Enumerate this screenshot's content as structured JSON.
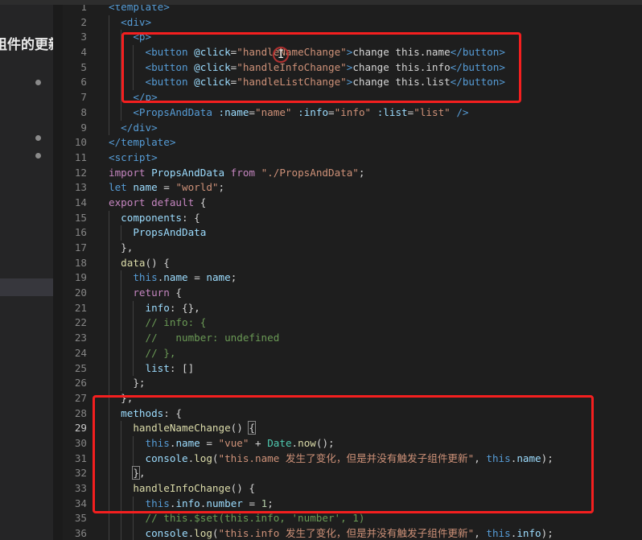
{
  "side_panel": {
    "title": "组件的更新"
  },
  "cursor": {
    "glyph": "I"
  },
  "colors": {
    "annotation_box": "#f41f1f",
    "keyword": "#c586c0",
    "string": "#ce9178",
    "comment": "#6a9955",
    "tag": "#569cd6"
  },
  "editor": {
    "active_line": 29,
    "lines": [
      {
        "n": "1",
        "t": [
          [
            "tag",
            "<template>"
          ]
        ]
      },
      {
        "n": "2",
        "t": [
          [
            "txt",
            "  "
          ],
          [
            "tag",
            "<div>"
          ]
        ]
      },
      {
        "n": "3",
        "t": [
          [
            "txt",
            "    "
          ],
          [
            "tag",
            "<p>"
          ]
        ]
      },
      {
        "n": "4",
        "t": [
          [
            "txt",
            "      "
          ],
          [
            "tag",
            "<button "
          ],
          [
            "attr",
            "@click"
          ],
          [
            "txt",
            "="
          ],
          [
            "str",
            "\"handleNameChange\""
          ],
          [
            "tag",
            ">"
          ],
          [
            "txt",
            "change this.name"
          ],
          [
            "tag",
            "</button>"
          ]
        ]
      },
      {
        "n": "5",
        "t": [
          [
            "txt",
            "      "
          ],
          [
            "tag",
            "<button "
          ],
          [
            "attr",
            "@click"
          ],
          [
            "txt",
            "="
          ],
          [
            "str",
            "\"handleInfoChange\""
          ],
          [
            "tag",
            ">"
          ],
          [
            "txt",
            "change this.info"
          ],
          [
            "tag",
            "</button>"
          ]
        ]
      },
      {
        "n": "6",
        "t": [
          [
            "txt",
            "      "
          ],
          [
            "tag",
            "<button "
          ],
          [
            "attr",
            "@click"
          ],
          [
            "txt",
            "="
          ],
          [
            "str",
            "\"handleListChange\""
          ],
          [
            "tag",
            ">"
          ],
          [
            "txt",
            "change this.list"
          ],
          [
            "tag",
            "</button>"
          ]
        ]
      },
      {
        "n": "7",
        "t": [
          [
            "txt",
            "    "
          ],
          [
            "tag",
            "</p>"
          ]
        ]
      },
      {
        "n": "8",
        "t": [
          [
            "txt",
            "    "
          ],
          [
            "tag",
            "<PropsAndData "
          ],
          [
            "attr",
            ":name"
          ],
          [
            "txt",
            "="
          ],
          [
            "str",
            "\"name\""
          ],
          [
            "txt",
            " "
          ],
          [
            "attr",
            ":info"
          ],
          [
            "txt",
            "="
          ],
          [
            "str",
            "\"info\""
          ],
          [
            "txt",
            " "
          ],
          [
            "attr",
            ":list"
          ],
          [
            "txt",
            "="
          ],
          [
            "str",
            "\"list\""
          ],
          [
            "txt",
            " "
          ],
          [
            "tag",
            "/>"
          ]
        ]
      },
      {
        "n": "9",
        "t": [
          [
            "txt",
            "  "
          ],
          [
            "tag",
            "</div>"
          ]
        ]
      },
      {
        "n": "10",
        "t": [
          [
            "tag",
            "</template>"
          ]
        ]
      },
      {
        "n": "11",
        "t": [
          [
            "tag",
            "<script>"
          ]
        ]
      },
      {
        "n": "12",
        "t": [
          [
            "kw",
            "import "
          ],
          [
            "var",
            "PropsAndData "
          ],
          [
            "kw",
            "from "
          ],
          [
            "str",
            "\"./PropsAndData\""
          ],
          [
            "txt",
            ";"
          ]
        ]
      },
      {
        "n": "13",
        "t": [
          [
            "kwb",
            "let "
          ],
          [
            "var",
            "name"
          ],
          [
            "txt",
            " = "
          ],
          [
            "str",
            "\"world\""
          ],
          [
            "txt",
            ";"
          ]
        ]
      },
      {
        "n": "14",
        "t": [
          [
            "kw",
            "export default "
          ],
          [
            "txt",
            "{"
          ]
        ]
      },
      {
        "n": "15",
        "t": [
          [
            "txt",
            "  "
          ],
          [
            "var",
            "components"
          ],
          [
            "txt",
            ": {"
          ]
        ]
      },
      {
        "n": "16",
        "t": [
          [
            "txt",
            "    "
          ],
          [
            "var",
            "PropsAndData"
          ]
        ]
      },
      {
        "n": "17",
        "t": [
          [
            "txt",
            "  },"
          ]
        ]
      },
      {
        "n": "18",
        "t": [
          [
            "txt",
            "  "
          ],
          [
            "fn",
            "data"
          ],
          [
            "txt",
            "() {"
          ]
        ]
      },
      {
        "n": "19",
        "t": [
          [
            "txt",
            "    "
          ],
          [
            "kwb",
            "this"
          ],
          [
            "txt",
            "."
          ],
          [
            "var",
            "name"
          ],
          [
            "txt",
            " = "
          ],
          [
            "var",
            "name"
          ],
          [
            "txt",
            ";"
          ]
        ]
      },
      {
        "n": "20",
        "t": [
          [
            "txt",
            "    "
          ],
          [
            "kw",
            "return "
          ],
          [
            "txt",
            "{"
          ]
        ]
      },
      {
        "n": "21",
        "t": [
          [
            "txt",
            "      "
          ],
          [
            "var",
            "info"
          ],
          [
            "txt",
            ": {},"
          ]
        ]
      },
      {
        "n": "22",
        "t": [
          [
            "txt",
            "      "
          ],
          [
            "cmt",
            "// info: {"
          ]
        ]
      },
      {
        "n": "23",
        "t": [
          [
            "txt",
            "      "
          ],
          [
            "cmt",
            "//   number: undefined"
          ]
        ]
      },
      {
        "n": "24",
        "t": [
          [
            "txt",
            "      "
          ],
          [
            "cmt",
            "// },"
          ]
        ]
      },
      {
        "n": "25",
        "t": [
          [
            "txt",
            "      "
          ],
          [
            "var",
            "list"
          ],
          [
            "txt",
            ": []"
          ]
        ]
      },
      {
        "n": "26",
        "t": [
          [
            "txt",
            "    };"
          ]
        ]
      },
      {
        "n": "27",
        "t": [
          [
            "txt",
            "  },"
          ]
        ]
      },
      {
        "n": "28",
        "t": [
          [
            "txt",
            "  "
          ],
          [
            "var",
            "methods"
          ],
          [
            "txt",
            ": {"
          ]
        ]
      },
      {
        "n": "29",
        "t": [
          [
            "txt",
            "    "
          ],
          [
            "fn",
            "handleNameChange"
          ],
          [
            "txt",
            "() "
          ],
          [
            "txt",
            "{"
          ]
        ]
      },
      {
        "n": "30",
        "t": [
          [
            "txt",
            "      "
          ],
          [
            "kwb",
            "this"
          ],
          [
            "txt",
            "."
          ],
          [
            "var",
            "name"
          ],
          [
            "txt",
            " = "
          ],
          [
            "str",
            "\"vue\""
          ],
          [
            "txt",
            " + "
          ],
          [
            "cls",
            "Date"
          ],
          [
            "txt",
            "."
          ],
          [
            "fn",
            "now"
          ],
          [
            "txt",
            "();"
          ]
        ]
      },
      {
        "n": "31",
        "t": [
          [
            "txt",
            "      "
          ],
          [
            "var",
            "console"
          ],
          [
            "txt",
            "."
          ],
          [
            "fn",
            "log"
          ],
          [
            "txt",
            "("
          ],
          [
            "str",
            "\"this.name 发生了变化，但是并没有触发子组件更新\""
          ],
          [
            "txt",
            ", "
          ],
          [
            "kwb",
            "this"
          ],
          [
            "txt",
            "."
          ],
          [
            "var",
            "name"
          ],
          [
            "txt",
            ");"
          ]
        ]
      },
      {
        "n": "32",
        "t": [
          [
            "txt",
            "    "
          ],
          [
            "txt",
            "}"
          ],
          [
            "txt",
            ","
          ]
        ]
      },
      {
        "n": "33",
        "t": [
          [
            "txt",
            "    "
          ],
          [
            "fn",
            "handleInfoChange"
          ],
          [
            "txt",
            "() {"
          ]
        ]
      },
      {
        "n": "34",
        "t": [
          [
            "txt",
            "      "
          ],
          [
            "kwb",
            "this"
          ],
          [
            "txt",
            "."
          ],
          [
            "var",
            "info"
          ],
          [
            "txt",
            "."
          ],
          [
            "var",
            "number"
          ],
          [
            "txt",
            " = "
          ],
          [
            "num",
            "1"
          ],
          [
            "txt",
            ";"
          ]
        ]
      },
      {
        "n": "35",
        "t": [
          [
            "txt",
            "      "
          ],
          [
            "cmt",
            "// this.$set(this.info, 'number', 1)"
          ]
        ]
      },
      {
        "n": "36",
        "t": [
          [
            "txt",
            "      "
          ],
          [
            "var",
            "console"
          ],
          [
            "txt",
            "."
          ],
          [
            "fn",
            "log"
          ],
          [
            "txt",
            "("
          ],
          [
            "str",
            "\"this.info 发生了变化，但是并没有触发子组件更新\""
          ],
          [
            "txt",
            ", "
          ],
          [
            "kwb",
            "this"
          ],
          [
            "txt",
            "."
          ],
          [
            "var",
            "info"
          ],
          [
            "txt",
            ");"
          ]
        ]
      }
    ]
  }
}
